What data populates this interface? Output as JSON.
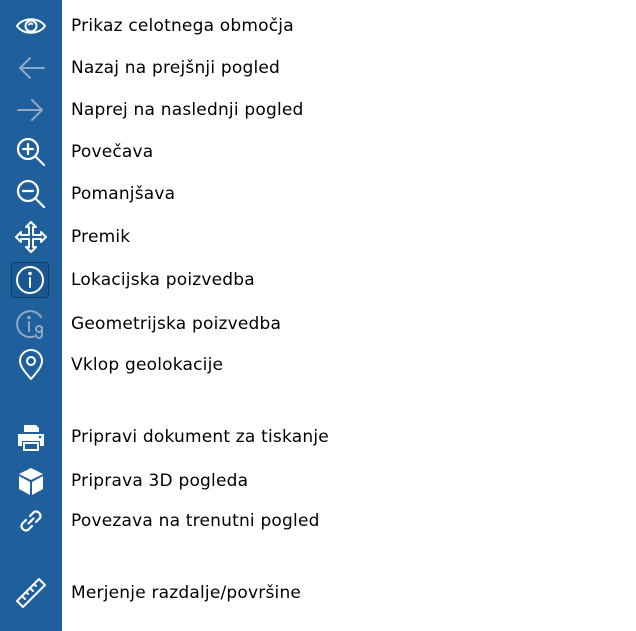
{
  "toolbar": {
    "items": [
      {
        "icon": "eye-icon",
        "label": "Prikaz celotnega območja",
        "enabled": true
      },
      {
        "icon": "arrow-left-icon",
        "label": "Nazaj na prejšnji pogled",
        "enabled": false
      },
      {
        "icon": "arrow-right-icon",
        "label": "Naprej na naslednji pogled",
        "enabled": false
      },
      {
        "icon": "zoom-in-icon",
        "label": "Povečava",
        "enabled": true
      },
      {
        "icon": "zoom-out-icon",
        "label": "Pomanjšava",
        "enabled": true
      },
      {
        "icon": "move-icon",
        "label": "Premik",
        "enabled": true
      },
      {
        "icon": "info-icon",
        "label": "Lokacijska poizvedba",
        "enabled": true,
        "active": true
      },
      {
        "icon": "info-geometry-icon",
        "label": "Geometrijska poizvedba",
        "enabled": false
      },
      {
        "icon": "location-pin-icon",
        "label": "Vklop geolokacije",
        "enabled": true
      },
      {
        "icon": "printer-icon",
        "label": "Pripravi dokument za tiskanje",
        "enabled": true
      },
      {
        "icon": "cube-icon",
        "label": "Priprava 3D pogleda",
        "enabled": true
      },
      {
        "icon": "link-icon",
        "label": "Povezava na trenutni pogled",
        "enabled": true
      },
      {
        "icon": "ruler-icon",
        "label": "Merjenje razdalje/površine",
        "enabled": true
      }
    ]
  },
  "colors": {
    "sidebar": "#1f5f9b",
    "icon": "#ffffff",
    "icon_disabled": "#8fa9c6",
    "active_border": "#0d3f6e"
  }
}
